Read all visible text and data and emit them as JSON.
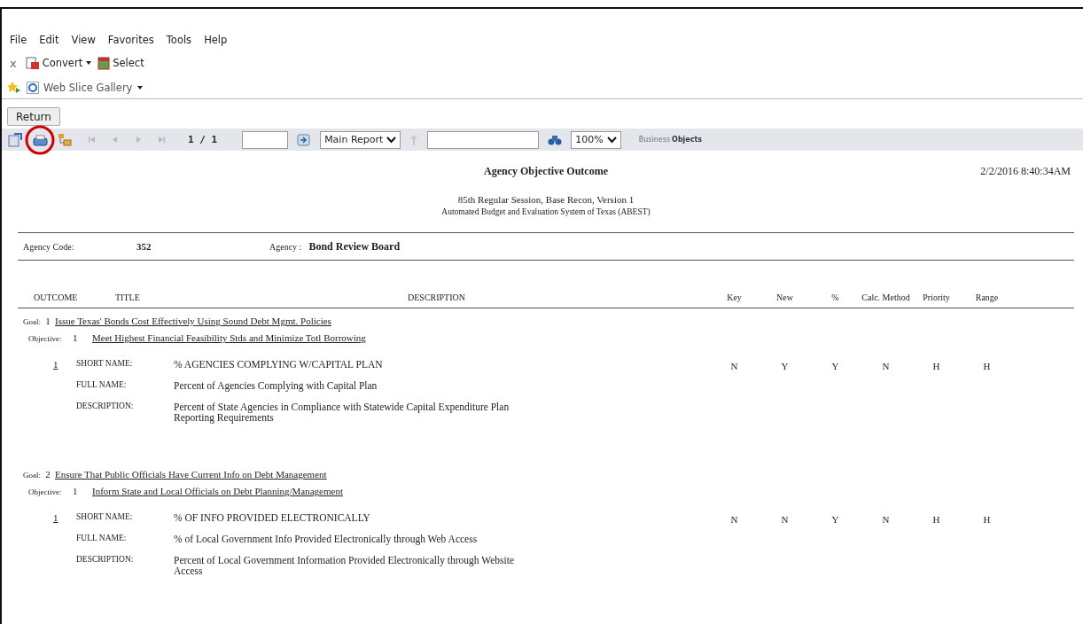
{
  "menu": [
    "File",
    "Edit",
    "View",
    "Favorites",
    "Tools",
    "Help"
  ],
  "command_bar": [
    {
      "kind": "close",
      "label": "x",
      "dropdown": false
    },
    {
      "kind": "convert",
      "label": "Convert",
      "dropdown": true
    },
    {
      "kind": "select",
      "label": "Select",
      "dropdown": false
    }
  ],
  "favorites_bar": [
    {
      "label": "Web Slice Gallery",
      "dropdown": true
    }
  ],
  "return_button": "Return",
  "report_toolbar": {
    "tools": [
      {
        "kind": "export"
      },
      {
        "kind": "print"
      },
      {
        "kind": "tree"
      }
    ],
    "nav": [
      {
        "kind": "first",
        "disabled": true
      },
      {
        "kind": "prev",
        "disabled": true
      },
      {
        "kind": "next",
        "disabled": true
      },
      {
        "kind": "last",
        "disabled": true
      }
    ],
    "page": "1 / 1",
    "group": "Main Report",
    "parent_disabled": true,
    "zoom": "100%",
    "logo": [
      "Business",
      "Objects"
    ]
  },
  "report": {
    "title": "Agency Objective Outcome",
    "date": "2/2/2016  8:40:34AM",
    "subtitle": "85th Regular Session, Base Recon, Version 1",
    "system": "Automated Budget and Evaluation System of Texas (ABEST)",
    "agency_code_label": "Agency Code:",
    "agency_code": "352",
    "agency_label": "Agency :",
    "agency": "Bond Review Board",
    "columns": [
      "OUTCOME",
      "TITLE",
      "DESCRIPTION",
      "Key",
      "New",
      "%",
      "Calc. Method",
      "Priority",
      "Range"
    ],
    "goals": [
      {
        "label": "Goal:",
        "number": "1",
        "title": "Issue Texas' Bonds Cost Effectively Using Sound Debt Mgmt. Policies",
        "objectives": [
          {
            "label": "Objective:",
            "number": "1",
            "title": "Meet Highest Financial Feasibility Stds and Minimize Totl Borrowing",
            "measures": [
              {
                "number": "1",
                "flags": [
                  "N",
                  "Y",
                  "Y",
                  "N",
                  "H",
                  "H"
                ],
                "fields": [
                  {
                    "label": "SHORT NAME:",
                    "value": "% AGENCIES COMPLYING W/CAPITAL PLAN"
                  },
                  {
                    "label": "FULL NAME:",
                    "value": "Percent of Agencies Complying with Capital Plan"
                  },
                  {
                    "label": "DESCRIPTION:",
                    "value": "Percent of State Agencies in Compliance with Statewide Capital Expenditure Plan Reporting Requirements"
                  }
                ]
              }
            ]
          }
        ]
      },
      {
        "label": "Goal:",
        "number": "2",
        "title": "Ensure That Public Officials Have Current Info on Debt Management",
        "objectives": [
          {
            "label": "Objective:",
            "number": "1",
            "title": "Inform State and Local Officials on Debt Planning/Management",
            "measures": [
              {
                "number": "1",
                "flags": [
                  "N",
                  "N",
                  "Y",
                  "N",
                  "H",
                  "H"
                ],
                "fields": [
                  {
                    "label": "SHORT NAME:",
                    "value": "% OF INFO PROVIDED ELECTRONICALLY"
                  },
                  {
                    "label": "FULL NAME:",
                    "value": "% of Local Government Info Provided Electronically through Web Access"
                  },
                  {
                    "label": "DESCRIPTION:",
                    "value": "Percent of Local Government Information Provided Electronically through Website Access"
                  }
                ]
              }
            ]
          }
        ]
      }
    ]
  }
}
